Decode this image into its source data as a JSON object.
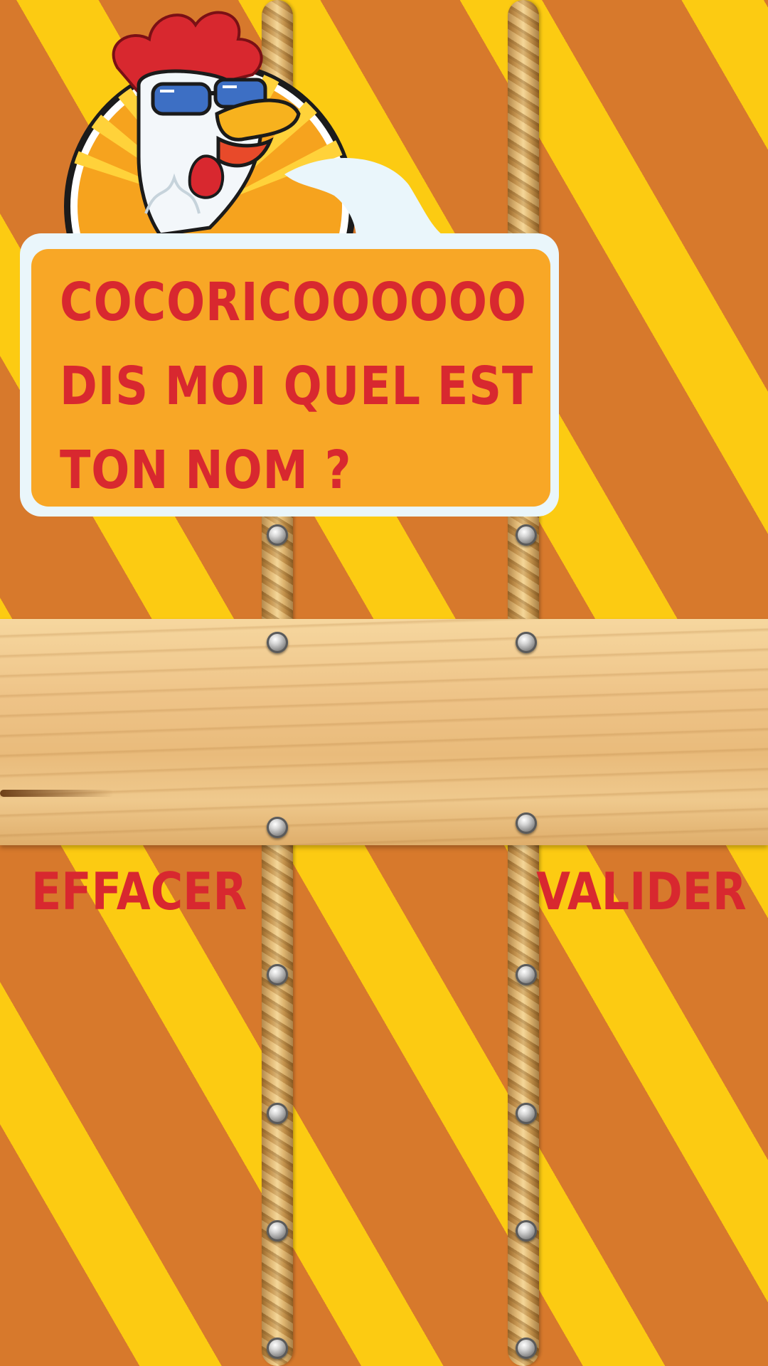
{
  "dialog": {
    "lines": [
      "COCORICOOOOOO",
      "DIS MOI QUEL EST",
      "TON NOM ?"
    ]
  },
  "actions": {
    "clear_label": "EFFACER",
    "validate_label": "VALIDER"
  },
  "colors": {
    "stripe_orange": "#D7792C",
    "stripe_yellow": "#FCCB12",
    "bubble_fill": "#F8A726",
    "bubble_border": "#EAF6FB",
    "text_red": "#D8282F"
  },
  "icons": {
    "mascot": "rooster-with-sunglasses-icon",
    "fastener": "screw-icon"
  }
}
